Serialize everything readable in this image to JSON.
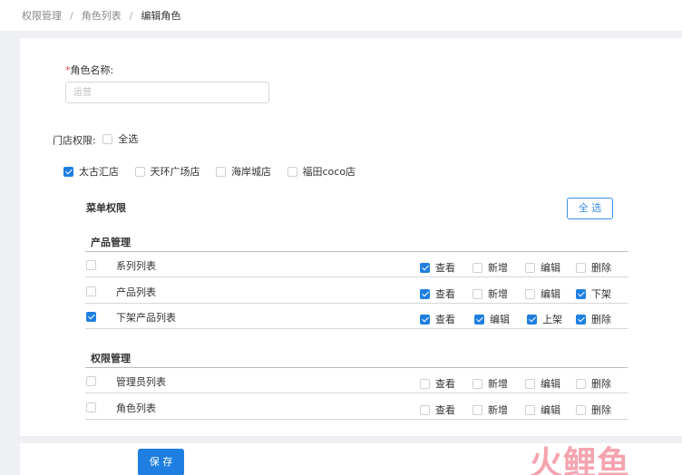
{
  "breadcrumb": {
    "items": [
      "权限管理",
      "角色列表"
    ],
    "current": "编辑角色",
    "separator": "/"
  },
  "role_name": {
    "label": "角色名称:",
    "required_mark": "*",
    "value": "",
    "placeholder": "运营"
  },
  "store_permission": {
    "label": "门店权限:",
    "select_all_label": "全选",
    "select_all_checked": false,
    "stores": [
      {
        "label": "太古汇店",
        "checked": true
      },
      {
        "label": "天环广场店",
        "checked": false
      },
      {
        "label": "海岸城店",
        "checked": false
      },
      {
        "label": "福田coco店",
        "checked": false
      }
    ]
  },
  "menu_permission": {
    "title": "菜单权限",
    "select_all_button": "全 选",
    "groups": [
      {
        "title": "产品管理",
        "rows": [
          {
            "label": "系列列表",
            "checked": false,
            "perms": [
              {
                "label": "查看",
                "checked": true
              },
              {
                "label": "新增",
                "checked": false
              },
              {
                "label": "编辑",
                "checked": false
              },
              {
                "label": "删除",
                "checked": false
              }
            ]
          },
          {
            "label": "产品列表",
            "checked": false,
            "perms": [
              {
                "label": "查看",
                "checked": true
              },
              {
                "label": "新增",
                "checked": false
              },
              {
                "label": "编辑",
                "checked": false
              },
              {
                "label": "下架",
                "checked": true
              }
            ]
          },
          {
            "label": "下架产品列表",
            "checked": true,
            "perms": [
              {
                "label": "查看",
                "checked": true
              },
              {
                "label": "编辑",
                "checked": true
              },
              {
                "label": "上架",
                "checked": true
              },
              {
                "label": "删除",
                "checked": true
              }
            ]
          }
        ]
      },
      {
        "title": "权限管理",
        "rows": [
          {
            "label": "管理员列表",
            "checked": false,
            "perms": [
              {
                "label": "查看",
                "checked": false
              },
              {
                "label": "新增",
                "checked": false
              },
              {
                "label": "编辑",
                "checked": false
              },
              {
                "label": "删除",
                "checked": false
              }
            ]
          },
          {
            "label": "角色列表",
            "checked": false,
            "perms": [
              {
                "label": "查看",
                "checked": false
              },
              {
                "label": "新增",
                "checked": false
              },
              {
                "label": "编辑",
                "checked": false
              },
              {
                "label": "删除",
                "checked": false
              }
            ]
          }
        ]
      }
    ]
  },
  "footer": {
    "save_button": "保 存"
  },
  "watermark": "火鲤鱼",
  "colors": {
    "primary": "#1f7fe0",
    "required": "#e54b4b",
    "background": "#eef0f3"
  }
}
